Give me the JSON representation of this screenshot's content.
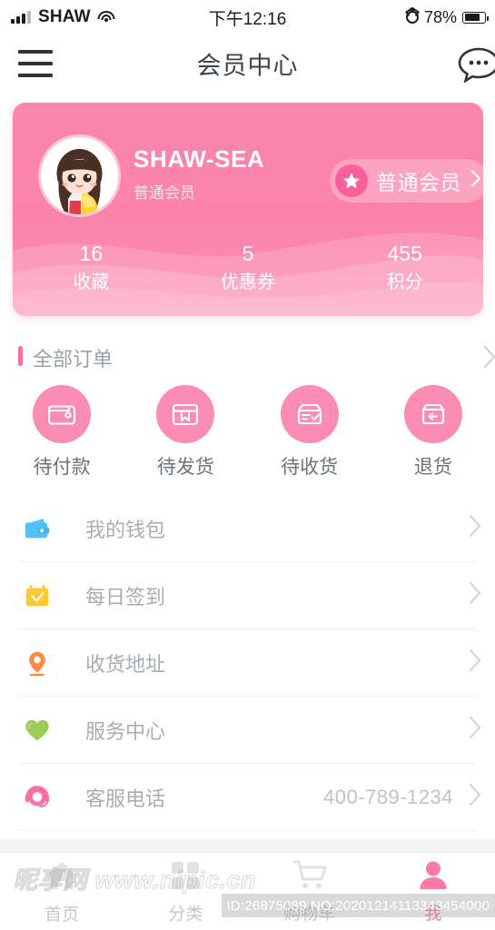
{
  "status_bar": {
    "carrier": "SHAW",
    "time": "下午12:16",
    "battery_percent": "78%",
    "icons": [
      "signal-bars-icon",
      "wifi-icon",
      "alarm-clock-icon",
      "battery-icon"
    ]
  },
  "nav": {
    "title": "会员中心",
    "menu_icon": "hamburger-menu-icon",
    "chat_icon": "chat-bubble-icon"
  },
  "profile": {
    "username": "SHAW-SEA",
    "level": "普通会员",
    "badge_label": "普通会员",
    "avatar_alt": "user-avatar",
    "stats": [
      {
        "value": "16",
        "label": "收藏"
      },
      {
        "value": "5",
        "label": "优惠券"
      },
      {
        "value": "455",
        "label": "积分"
      }
    ]
  },
  "orders": {
    "section_title": "全部订单",
    "items": [
      {
        "label": "待付款",
        "icon": "wallet-outline-icon"
      },
      {
        "label": "待发货",
        "icon": "package-box-icon"
      },
      {
        "label": "待收货",
        "icon": "delivery-check-icon"
      },
      {
        "label": "退货",
        "icon": "return-box-icon"
      }
    ]
  },
  "menu": {
    "items": [
      {
        "label": "我的钱包",
        "icon": "wallet-icon",
        "color": "#4FC3F7",
        "value": ""
      },
      {
        "label": "每日签到",
        "icon": "calendar-check-icon",
        "color": "#FFC935",
        "value": ""
      },
      {
        "label": "收货地址",
        "icon": "location-pin-icon",
        "color": "#FF8A47",
        "value": ""
      },
      {
        "label": "服务中心",
        "icon": "heart-icon",
        "color": "#9CCC55",
        "value": ""
      },
      {
        "label": "客服电话",
        "icon": "headset-icon",
        "color": "#FF6FA5",
        "value": "400-789-1234"
      }
    ]
  },
  "tabbar": {
    "items": [
      {
        "label": "首页",
        "icon": "home-icon",
        "active": false
      },
      {
        "label": "分类",
        "icon": "grid-icon",
        "active": false
      },
      {
        "label": "购物车",
        "icon": "cart-icon",
        "active": false
      },
      {
        "label": "我",
        "icon": "person-icon",
        "active": true
      }
    ]
  },
  "watermark": {
    "text": "昵享网 www.nipic.cn",
    "id_text": "ID:26875089 NO:20201214113343454000"
  },
  "colors": {
    "brand_pink": "#FB85AD",
    "accent_pink": "#FA6EA3",
    "text_gray": "#A8ADB4"
  }
}
